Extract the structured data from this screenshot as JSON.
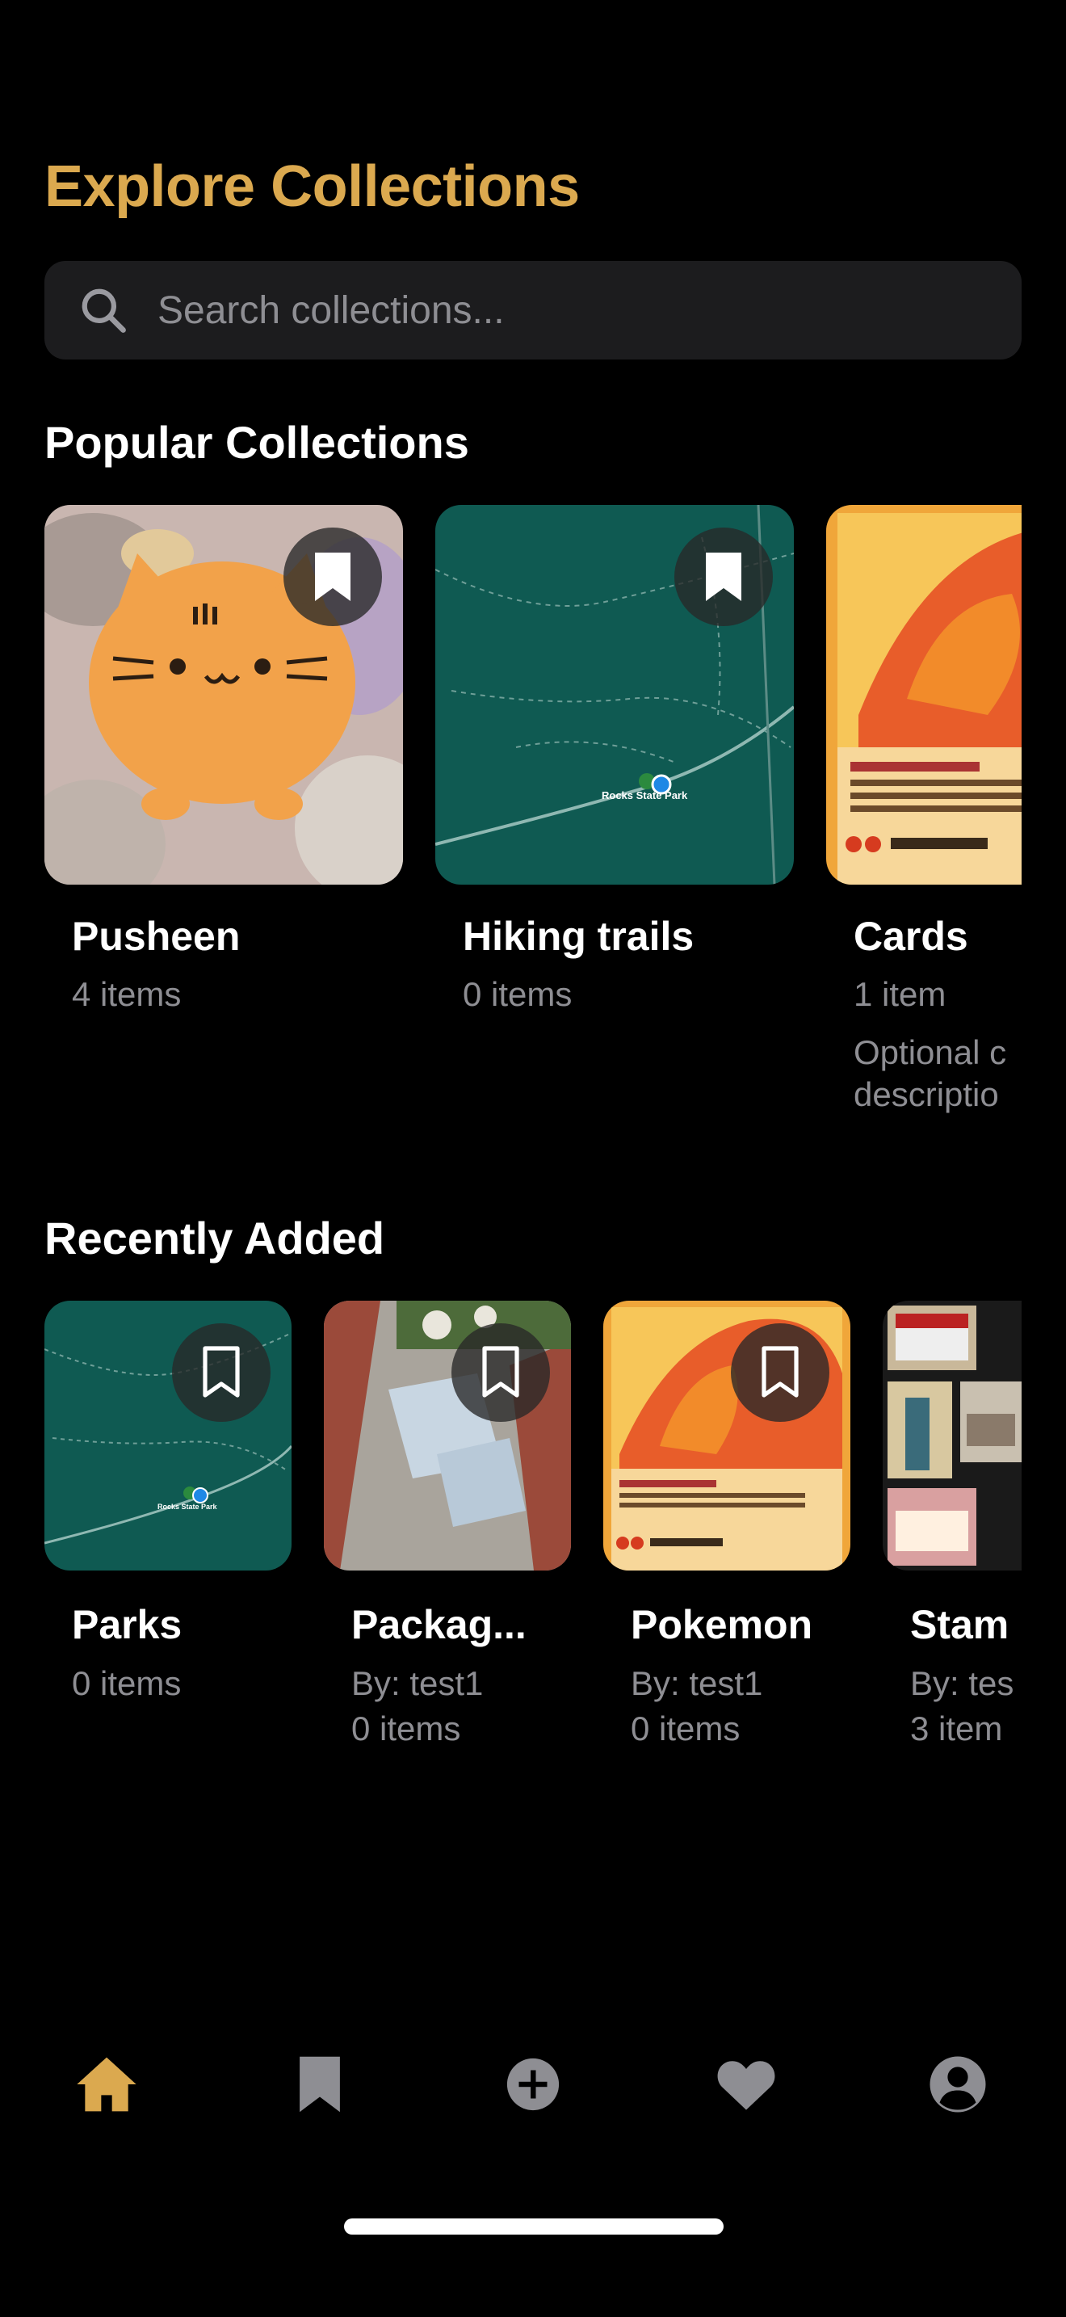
{
  "header": {
    "title": "Explore Collections"
  },
  "search": {
    "placeholder": "Search collections...",
    "icon": "search-icon"
  },
  "popular": {
    "title": "Popular Collections",
    "items": [
      {
        "title": "Pusheen",
        "count": "4 items"
      },
      {
        "title": "Hiking trails",
        "count": "0 items",
        "map_label": "Rocks State Park"
      },
      {
        "title": "Cards",
        "count": "1 item",
        "description": "Optional c descriptio"
      }
    ]
  },
  "recent": {
    "title": "Recently Added",
    "items": [
      {
        "title": "Parks",
        "count": "0 items",
        "map_label": "Rocks State Park"
      },
      {
        "title": "Packag...",
        "author": "By: test1",
        "count": "0 items"
      },
      {
        "title": "Pokemon",
        "author": "By: test1",
        "count": "0 items"
      },
      {
        "title": "Stam",
        "author": "By: tes",
        "count": "3 item"
      }
    ]
  },
  "tabbar": {
    "tabs": [
      {
        "name": "home",
        "icon": "home-icon",
        "active": true
      },
      {
        "name": "bookmarks",
        "icon": "bookmark-icon",
        "active": false
      },
      {
        "name": "add",
        "icon": "plus-circle-icon",
        "active": false
      },
      {
        "name": "favorites",
        "icon": "heart-icon",
        "active": false
      },
      {
        "name": "profile",
        "icon": "user-circle-icon",
        "active": false
      }
    ]
  },
  "colors": {
    "accent": "#dba94f",
    "background": "#000000",
    "search_bg": "#1c1c1e",
    "secondary_text": "#8e8e93",
    "tab_inactive": "#8e8e93"
  }
}
